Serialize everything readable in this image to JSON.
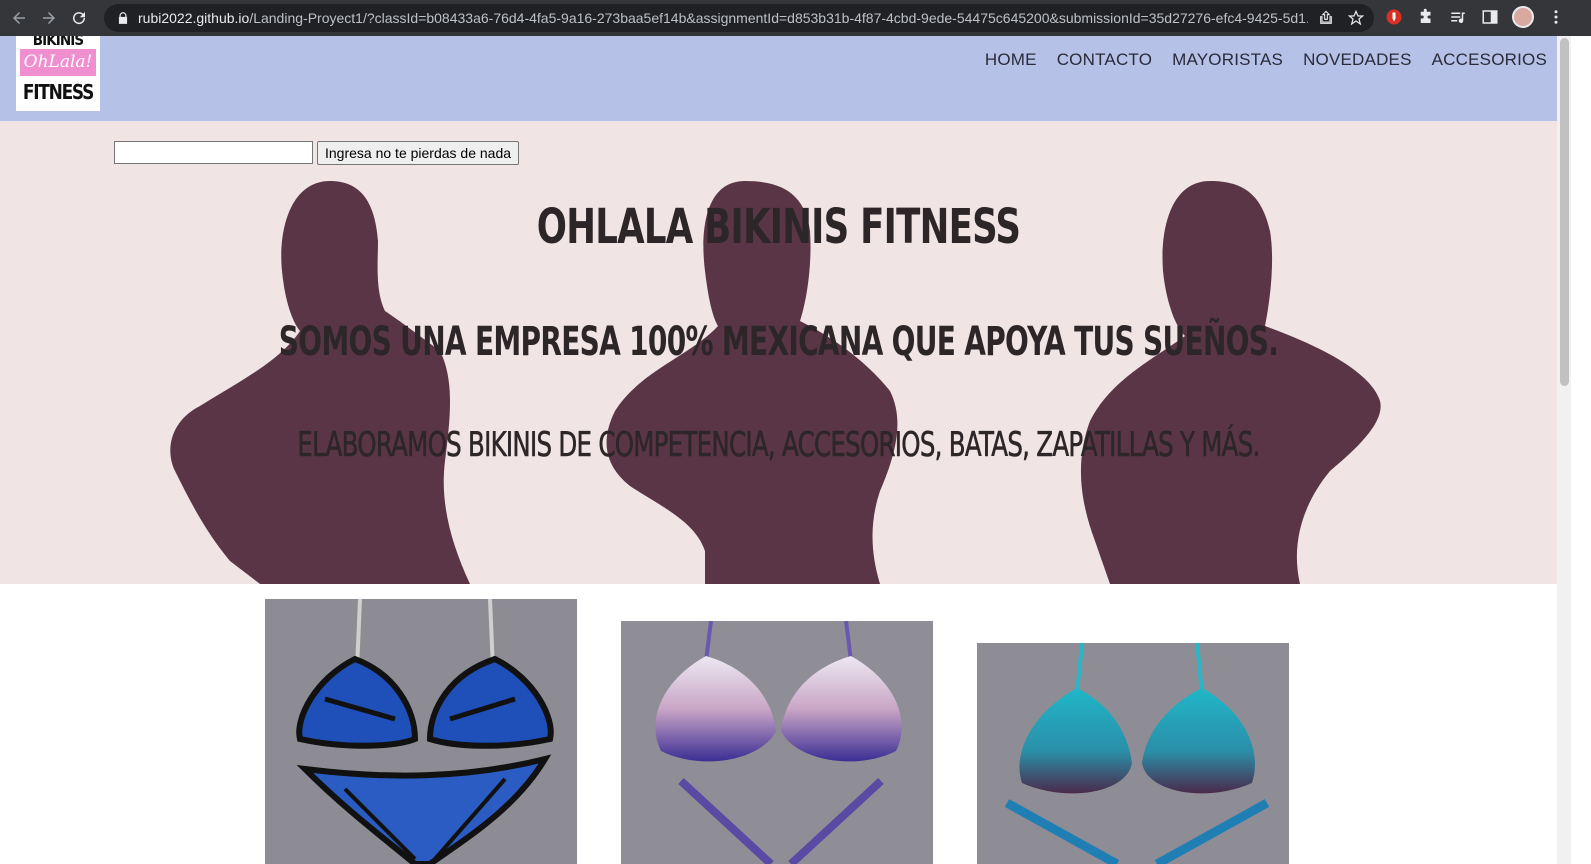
{
  "browser": {
    "url_host": "rubi2022.github.io",
    "url_path": "/Landing-Proyect1/?classId=b08433a6-76d4-4fa5-9a16-273baa5ef14b&assignmentId=d853b31b-4f87-4cbd-9ede-54475c645200&submissionId=35d27276-efc4-9425-5d1..."
  },
  "logo": {
    "line1": "BIKINIS",
    "line2": "OhLala!",
    "line3": "FITNESS"
  },
  "nav": {
    "items": [
      {
        "label": "HOME"
      },
      {
        "label": "CONTACTO"
      },
      {
        "label": "MAYORISTAS"
      },
      {
        "label": "NOVEDADES"
      },
      {
        "label": "ACCESORIOS"
      }
    ]
  },
  "subscribe": {
    "input_value": "",
    "button_label": "Ingresa no te pierdas de nada"
  },
  "hero": {
    "title": "OHLALA BIKINIS FITNESS",
    "subtitle": "SOMOS UNA EMPRESA 100% MEXICANA QUE APOYA TUS SUEÑOS.",
    "tagline": "ELABORAMOS BIKINIS DE COMPETENCIA, ACCESORIOS, BATAS, ZAPATILLAS Y MÁS."
  },
  "products": [
    {
      "name": "blue-butterfly-bikini"
    },
    {
      "name": "purple-ombre-bikini"
    },
    {
      "name": "teal-crystal-bikini"
    }
  ],
  "colors": {
    "header_bg": "#b5c1e6",
    "hero_bg": "#f0e4e4",
    "silhouette": "#5a3546",
    "logo_pink": "#ef8fd0"
  }
}
